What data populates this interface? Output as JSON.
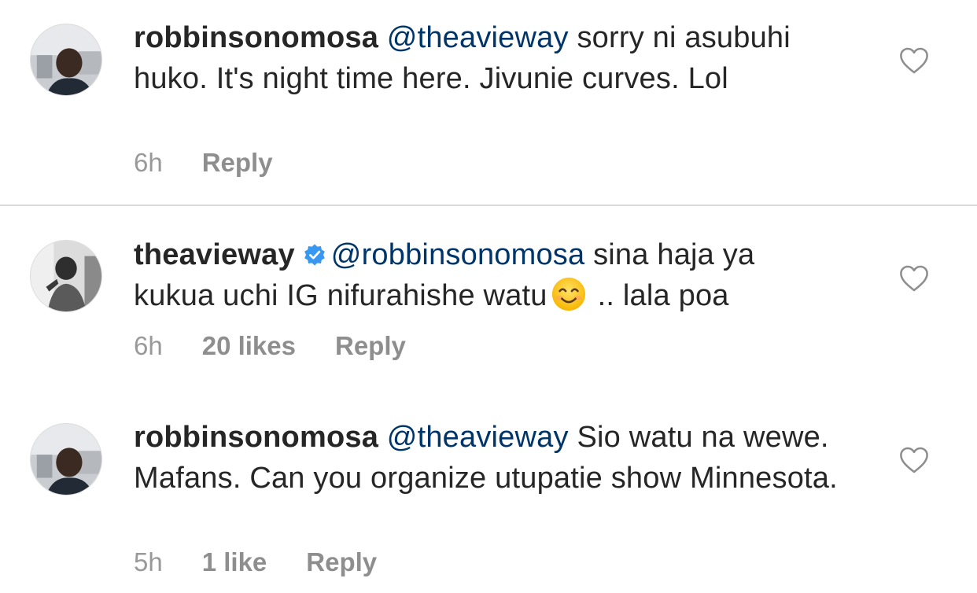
{
  "comments": [
    {
      "username": "robbinsonomosa",
      "mention": "@theavieway",
      "text": "sorry ni asubuhi huko. It's night time here. Jivunie curves. Lol",
      "time": "6h",
      "likes": "",
      "reply": "Reply",
      "verified": false
    },
    {
      "username": "theavieway",
      "mention": "@robbinsonomosa",
      "text": "sina haja ya kukua uchi IG nifurahishe watu",
      "text_after_emoji": ".. lala poa",
      "time": "6h",
      "likes": "20 likes",
      "reply": "Reply",
      "verified": true
    },
    {
      "username": "robbinsonomosa",
      "mention": "@theavieway",
      "text": "Sio watu na wewe. Mafans. Can you organize utupatie show Minnesota.",
      "time": "5h",
      "likes": "1 like",
      "reply": "Reply",
      "verified": false
    }
  ],
  "colors": {
    "mention": "#003569",
    "meta": "#8e8e8e",
    "verified": "#3897f0",
    "divider": "#dbdbdb"
  }
}
